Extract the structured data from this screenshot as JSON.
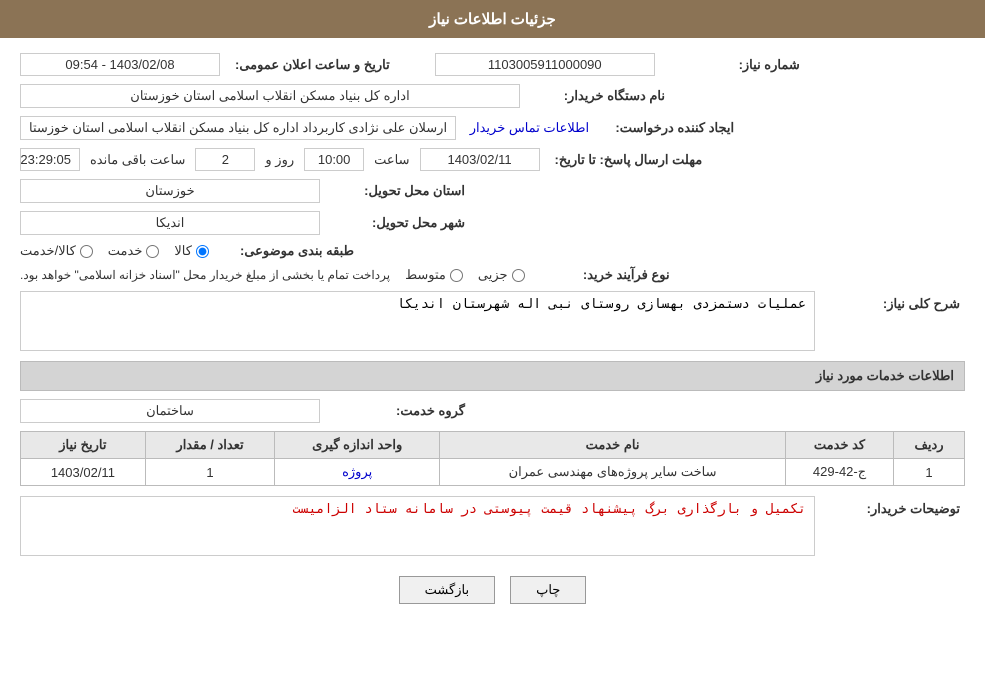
{
  "header": {
    "title": "جزئیات اطلاعات نیاز"
  },
  "fields": {
    "need_number_label": "شماره نیاز:",
    "need_number_value": "1103005911000090",
    "buyer_name_label": "نام دستگاه خریدار:",
    "buyer_name_value": "اداره کل بنیاد مسکن انقلاب اسلامی استان خوزستان",
    "creator_label": "ایجاد کننده درخواست:",
    "creator_value": "ارسلان علی نژادی کاربرداد اداره کل بنیاد مسکن انقلاب اسلامی استان خوزستا",
    "creator_link": "اطلاعات تماس خریدار",
    "response_deadline_label": "مهلت ارسال پاسخ: تا تاریخ:",
    "date_value": "1403/02/11",
    "time_label": "ساعت",
    "time_value": "10:00",
    "day_label": "روز و",
    "day_value": "2",
    "remaining_label": "ساعت باقی مانده",
    "remaining_value": "23:29:05",
    "announce_label": "تاریخ و ساعت اعلان عمومی:",
    "announce_value": "1403/02/08 - 09:54",
    "province_label": "استان محل تحویل:",
    "province_value": "خوزستان",
    "city_label": "شهر محل تحویل:",
    "city_value": "اندیکا",
    "category_label": "طبقه بندی موضوعی:",
    "category_options": [
      "کالا",
      "خدمت",
      "کالا/خدمت"
    ],
    "category_selected": "کالا",
    "purchase_type_label": "نوع فرآیند خرید:",
    "purchase_options": [
      "جزیی",
      "متوسط"
    ],
    "purchase_note": "پرداخت تمام یا بخشی از مبلغ خریدار محل \"اسناد خزانه اسلامی\" خواهد بود.",
    "need_description_label": "شرح کلی نیاز:",
    "need_description_value": "عملیات دستمزدی بهسازی روستای نبی اله شهرستان اندیکا",
    "services_header": "اطلاعات خدمات مورد نیاز",
    "service_group_label": "گروه خدمت:",
    "service_group_value": "ساختمان",
    "table": {
      "columns": [
        "ردیف",
        "کد خدمت",
        "نام خدمت",
        "واحد اندازه گیری",
        "تعداد / مقدار",
        "تاریخ نیاز"
      ],
      "rows": [
        {
          "row": "1",
          "code": "ج-42-429",
          "name": "ساخت سایر پروژه‌های مهندسی عمران",
          "unit": "پروژه",
          "count": "1",
          "date": "1403/02/11"
        }
      ]
    },
    "buyer_notes_label": "توضیحات خریدار:",
    "buyer_notes_value": "تکمیل و بارگذاری برگ پیشنهاد قیمت پیوستی در سامانه ستاد الزامیست",
    "btn_print": "چاپ",
    "btn_back": "بازگشت"
  }
}
